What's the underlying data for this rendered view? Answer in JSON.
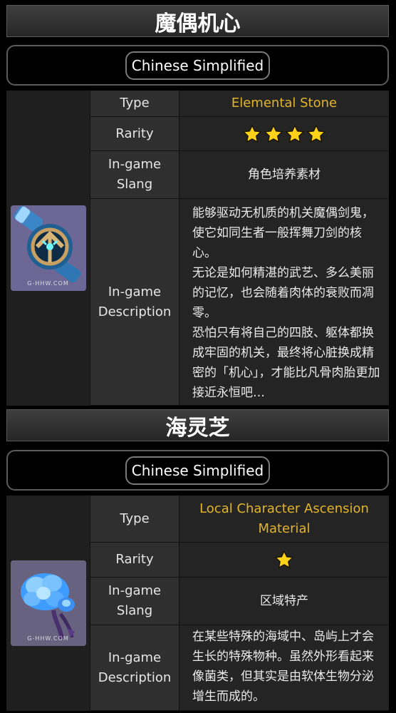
{
  "items": [
    {
      "title": "魔偶机心",
      "language": "Chinese Simplified",
      "type_label": "Type",
      "type_value": "Elemental Stone",
      "rarity_label": "Rarity",
      "rarity_stars": 4,
      "slang_label": "In-game Slang",
      "slang_value": "角色培养素材",
      "desc_label": "In-game Description",
      "description": [
        "能够驱动无机质的机关魔偶剑鬼，使它如同生者一般挥舞刀剑的核心。",
        "无论是如何精湛的武艺、多么美丽的记忆，也会随着肉体的衰败而凋零。",
        "恐怕只有将自己的四肢、躯体都换成牢固的机关，最终将心脏换成精密的「机心」，才能比凡骨肉胎更加接近永恒吧…"
      ],
      "watermark": "G-HHW.COM",
      "icon": "clockwork-core-icon"
    },
    {
      "title": "海灵芝",
      "language": "Chinese Simplified",
      "type_label": "Type",
      "type_value": "Local Character Ascension Material",
      "rarity_label": "Rarity",
      "rarity_stars": 1,
      "slang_label": "In-game Slang",
      "slang_value": "区域特产",
      "desc_label": "In-game Description",
      "description": [
        "在某些特殊的海域中、岛屿上才会生长的特殊物种。虽然外形看起来像菌类，但其实是由软体生物分泌增生而成的。"
      ],
      "watermark": "G-HHW.COM",
      "icon": "sea-ganoderma-icon"
    }
  ],
  "colors": {
    "gold": "#e2b42b",
    "star": "#ffd21a"
  }
}
